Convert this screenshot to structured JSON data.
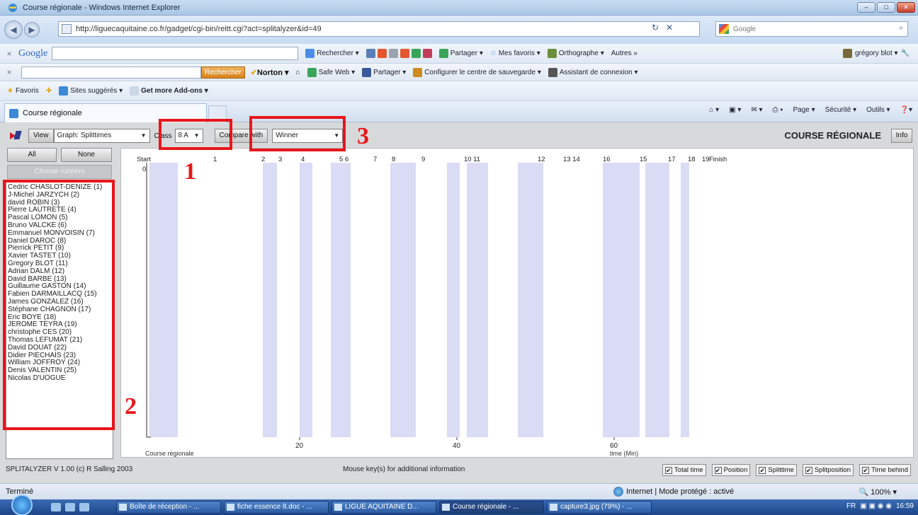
{
  "window": {
    "title": "Course régionale - Windows Internet Explorer",
    "controls": [
      "–",
      "□",
      "✕"
    ]
  },
  "address": {
    "url": "http://liguecaquitaine.co.fr/gadget/cgi-bin/reitt.cgi?act=splitalyzer&id=49",
    "search_placeholder": "Google"
  },
  "google_toolbar": {
    "logo": "Google",
    "items": [
      "Rechercher ▾",
      "Partager ▾",
      "Mes favoris ▾",
      "Orthographe ▾",
      "Autres »"
    ],
    "user": "grégory blot ▾"
  },
  "norton_toolbar": {
    "search_button": "Rechercher",
    "brand": "Norton ▾",
    "items": [
      "Safe Web ▾",
      "Partager ▾",
      "Configurer le centre de sauvegarde ▾",
      "Assistant de connexion ▾"
    ]
  },
  "favorites_bar": {
    "favoris": "Favoris",
    "items": [
      "Sites suggérés ▾",
      "Get more Add-ons ▾"
    ]
  },
  "tab": {
    "label": "Course régionale",
    "commands": [
      "Page ▾",
      "Sécurité ▾",
      "Outils ▾"
    ]
  },
  "app": {
    "view_label": "View",
    "view_value": "Graph: Splittimes",
    "class_label": "Class",
    "class_value": "8 A",
    "compare_label": "Compare with",
    "compare_value": "Winner",
    "title": "COURSE RÉGIONALE",
    "info_label": "Info",
    "all_label": "All",
    "none_label": "None",
    "choose_label": "Choose runners",
    "runners": [
      "Cedric CHASLOT-DENIZE (1)",
      "J-Michel JARZYCH (2)",
      "david ROBIN (3)",
      "Pierre LAUTRETE (4)",
      "Pascal LOMON (5)",
      "Bruno VALCKE (6)",
      "Emmanuel MONVOISIN (7)",
      "Daniel DAROC (8)",
      "Pierrick PETIT (9)",
      "Xavier TASTET (10)",
      "Gregory BLOT (11)",
      "Adrian DALM (12)",
      "David BARBE (13)",
      "Guillaume GASTON (14)",
      "Fabien DARMAILLACQ (15)",
      "James GONZALEZ (16)",
      "Stéphane CHAGNON (17)",
      "Eric BOYE (18)",
      "JEROME TEYRA (19)",
      "christophe CES (20)",
      "Thomas LEFUMAT (21)",
      "David DOUAT (22)",
      "Didier PIECHAIS (23)",
      "William JOFFROY (24)",
      "Denis VALENTIN (25)",
      "Nicolas D'UOGUE"
    ],
    "version": "SPLITALYZER V 1.00 (c) R Salling 2003",
    "mouse_hint": "Mouse key(s) for additional information",
    "checkboxes": [
      {
        "label": "Total time",
        "checked": true
      },
      {
        "label": "Position",
        "checked": true
      },
      {
        "label": "Splittime",
        "checked": true
      },
      {
        "label": "Splitposition",
        "checked": true
      },
      {
        "label": "Time behind",
        "checked": true
      }
    ]
  },
  "chart_data": {
    "type": "bar",
    "top_labels": [
      "Start",
      "1",
      "2",
      "3",
      "4",
      "5 6",
      "7",
      "8",
      "9",
      "10 11",
      "12",
      "13 14",
      "16",
      "15",
      "17",
      "18",
      "19",
      "Finish"
    ],
    "y_start": "0",
    "x_ticks": [
      "20",
      "40",
      "60"
    ],
    "bottom_left": "Course régionale",
    "xlabel": "time (Min)",
    "stripe_color": "#dadcf6"
  },
  "annotations": [
    "1",
    "2",
    "3"
  ],
  "status": {
    "left": "Terminé",
    "zone": "Internet | Mode protégé : activé",
    "zoom": "100%"
  },
  "taskbar": {
    "tasks": [
      "Boîte de réception - ...",
      "fiche essence 8.doc - ...",
      "LIGUE AQUITAINE D...",
      "Course régionale - ...",
      "capture3.jpg (79%) - ..."
    ],
    "lang": "FR",
    "clock": "16:59"
  }
}
